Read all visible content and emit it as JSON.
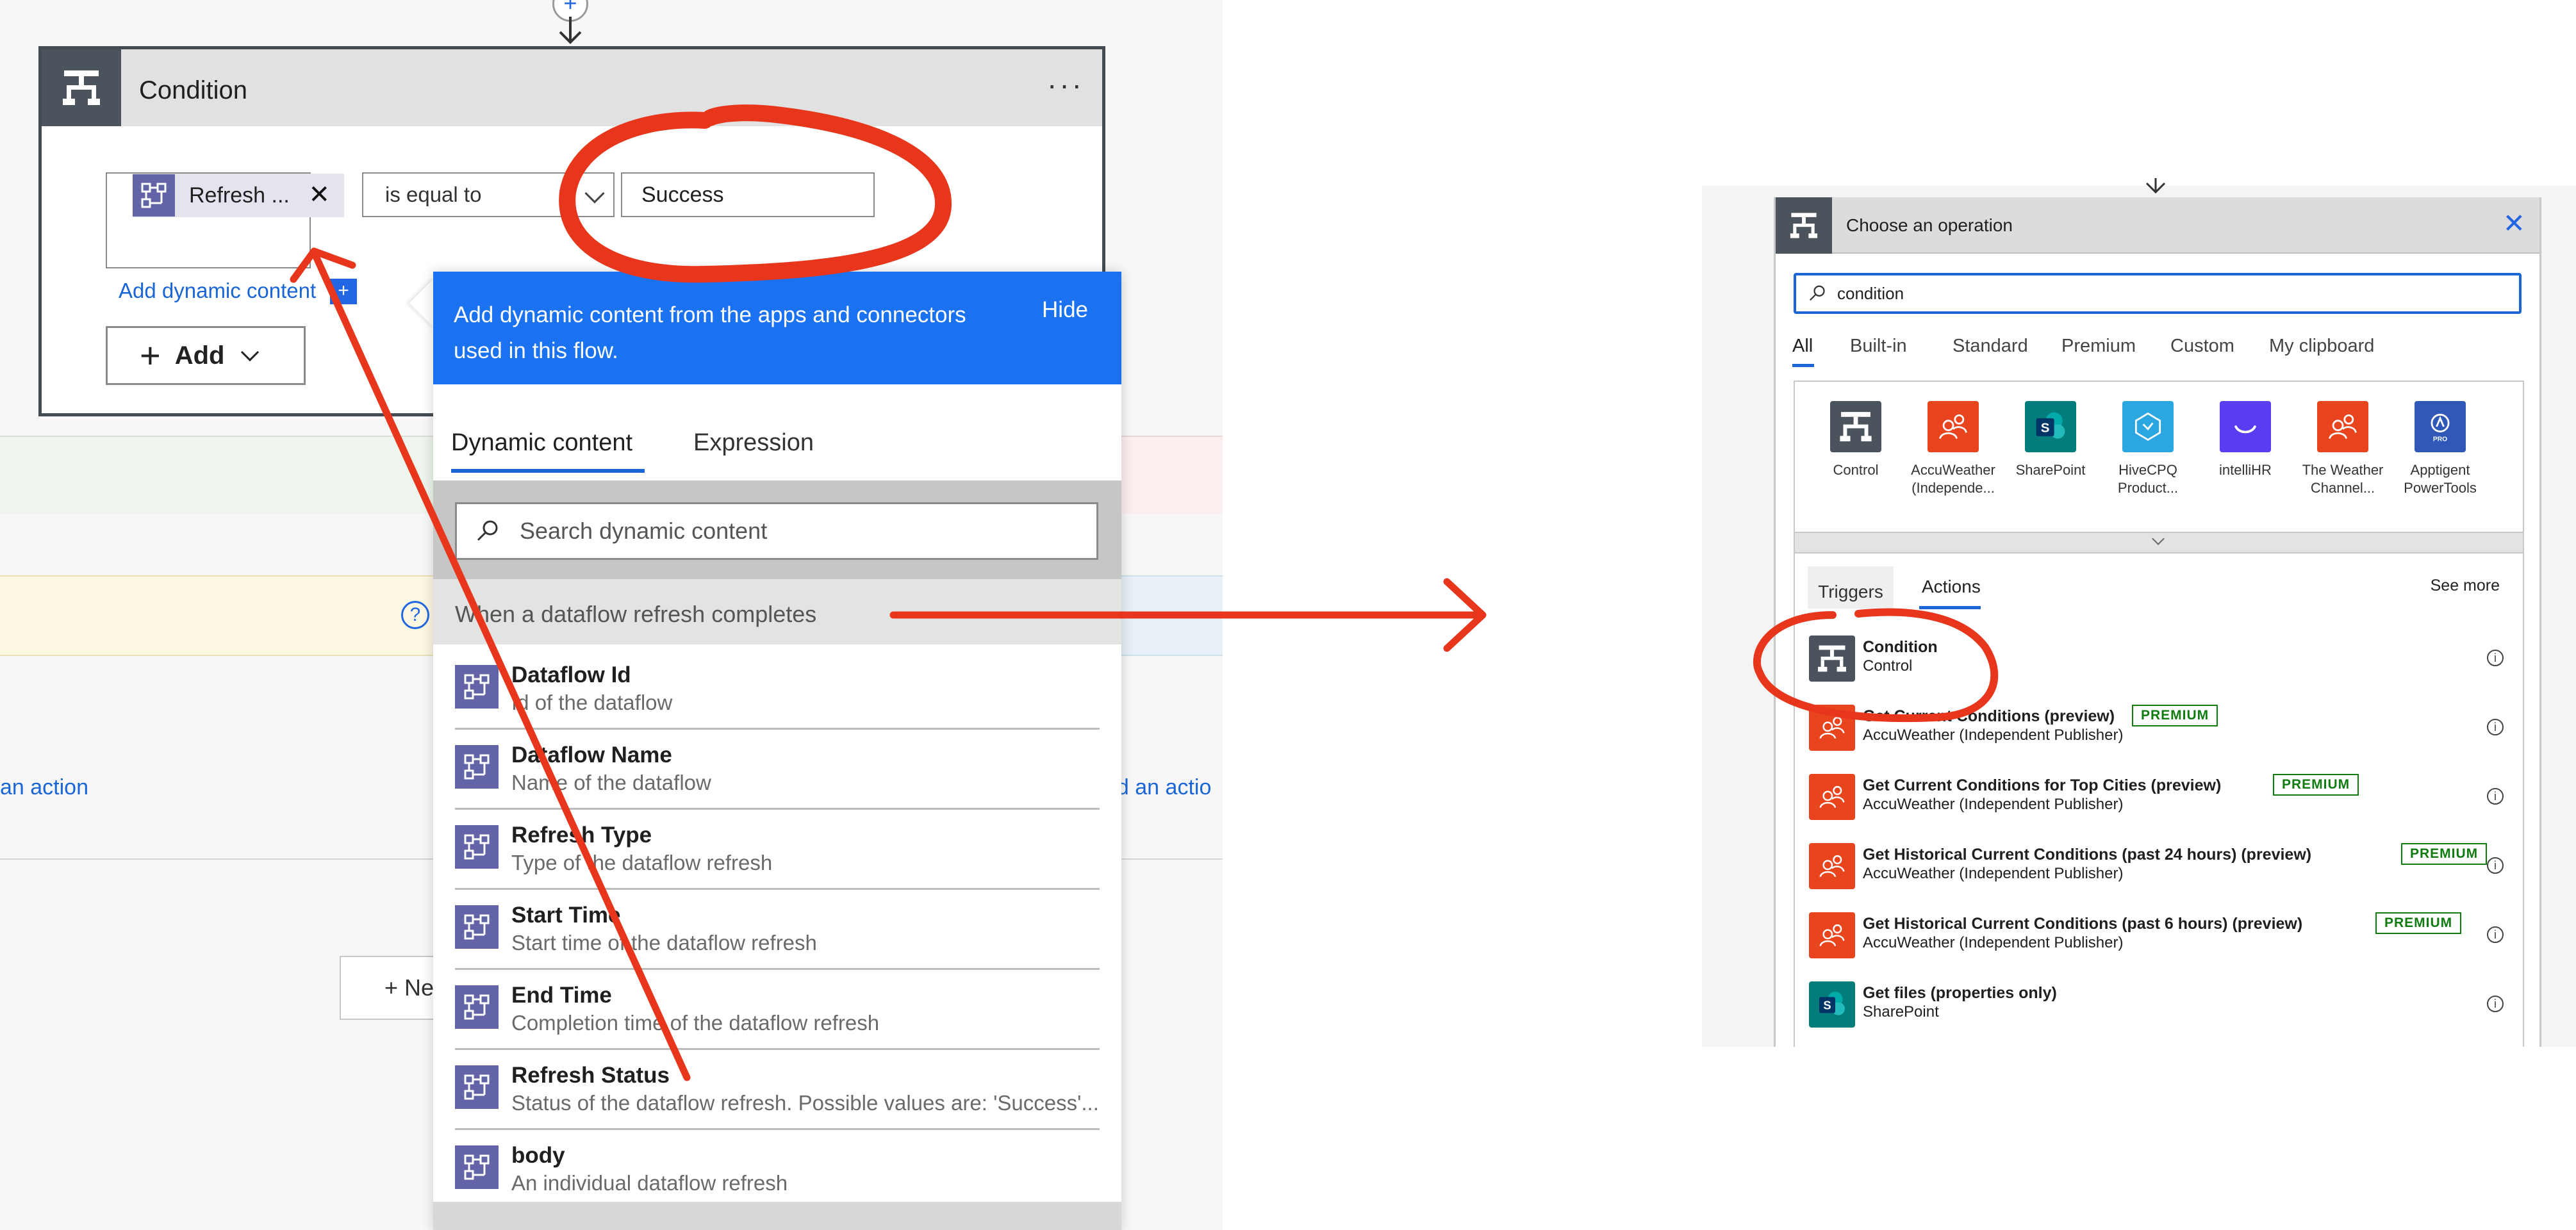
{
  "condition": {
    "title": "Condition",
    "more": "···",
    "token_label": "Refresh ...",
    "token_remove": "✕",
    "operator": "is equal to",
    "value": "Success",
    "add_dynamic": "Add dynamic content",
    "add_dynamic_plus": "+",
    "add_button": "Add"
  },
  "canvas": {
    "help": "?",
    "add_action_left": "an action",
    "add_action_right": "dd an actio",
    "new_step": "+ Ne",
    "top_plus": "+"
  },
  "dynamic_panel": {
    "header": "Add dynamic content from the apps and connectors used in this flow.",
    "hide": "Hide",
    "tabs": [
      "Dynamic content",
      "Expression"
    ],
    "search_placeholder": "Search dynamic content",
    "section_title": "When a dataflow refresh completes",
    "items": [
      {
        "title": "Dataflow Id",
        "desc": "Id of the dataflow"
      },
      {
        "title": "Dataflow Name",
        "desc": "Name of the dataflow"
      },
      {
        "title": "Refresh Type",
        "desc": "Type of the dataflow refresh"
      },
      {
        "title": "Start Time",
        "desc": "Start time of the dataflow refresh"
      },
      {
        "title": "End Time",
        "desc": "Completion time of the dataflow refresh"
      },
      {
        "title": "Refresh Status",
        "desc": "Status of the dataflow refresh. Possible values are: 'Success'..."
      },
      {
        "title": "body",
        "desc": "An individual dataflow refresh"
      }
    ]
  },
  "operation_panel": {
    "title": "Choose an operation",
    "close": "✕",
    "search_value": "condition",
    "tabs": [
      "All",
      "Built-in",
      "Standard",
      "Premium",
      "Custom",
      "My clipboard"
    ],
    "connectors": [
      {
        "name": "Control",
        "name2": "",
        "color": "#4b535c",
        "icon": "control-icon"
      },
      {
        "name": "AccuWeather",
        "name2": "(Independe...",
        "color": "#e8451f",
        "icon": "accuweather-icon"
      },
      {
        "name": "SharePoint",
        "name2": "",
        "color": "#037c7c",
        "icon": "sharepoint-icon"
      },
      {
        "name": "HiveCPQ",
        "name2": "Product...",
        "color": "#2aa6e0",
        "icon": "hivecpq-icon"
      },
      {
        "name": "intelliHR",
        "name2": "",
        "color": "#5a3df0",
        "icon": "intellihr-icon"
      },
      {
        "name": "The Weather",
        "name2": "Channel...",
        "color": "#e8451f",
        "icon": "weather-channel-icon"
      },
      {
        "name": "Apptigent",
        "name2": "PowerTools",
        "color": "#2f58b8",
        "icon": "apptigent-icon"
      }
    ],
    "result_tabs": [
      "Triggers",
      "Actions"
    ],
    "see_more": "See more",
    "results": [
      {
        "title": "Condition",
        "sub": "Control",
        "badge": "",
        "color": "#4b535c",
        "icon": "control-icon"
      },
      {
        "title": "Get Current Conditions (preview)",
        "sub": "AccuWeather (Independent Publisher)",
        "badge": "PREMIUM",
        "color": "#e8451f",
        "icon": "accuweather-icon"
      },
      {
        "title": "Get Current Conditions for Top Cities (preview)",
        "sub": "AccuWeather (Independent Publisher)",
        "badge": "PREMIUM",
        "color": "#e8451f",
        "icon": "accuweather-icon"
      },
      {
        "title": "Get Historical Current Conditions (past 24 hours) (preview)",
        "sub": "AccuWeather (Independent Publisher)",
        "badge": "PREMIUM",
        "color": "#e8451f",
        "icon": "accuweather-icon"
      },
      {
        "title": "Get Historical Current Conditions (past 6 hours) (preview)",
        "sub": "AccuWeather (Independent Publisher)",
        "badge": "PREMIUM",
        "color": "#e8451f",
        "icon": "accuweather-icon"
      },
      {
        "title": "Get files (properties only)",
        "sub": "SharePoint",
        "badge": "",
        "color": "#037c7c",
        "icon": "sharepoint-icon"
      }
    ],
    "info": "i"
  },
  "colors": {
    "accent_blue": "#1a72f0",
    "dataflow_purple": "#6264a7",
    "annotation_red": "#e8361d",
    "premium_green": "#107c10"
  }
}
